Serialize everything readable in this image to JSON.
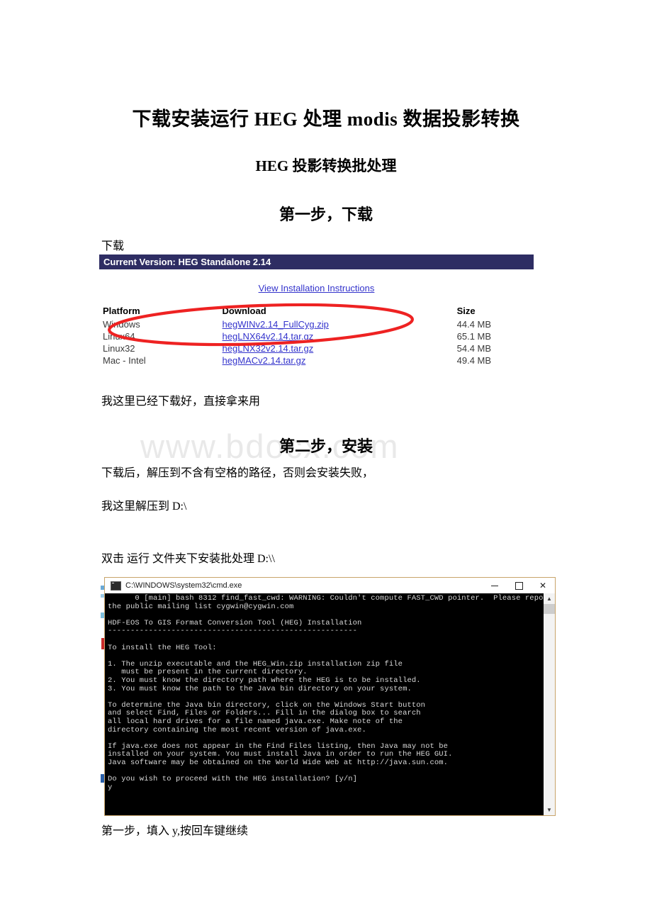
{
  "document": {
    "title_main": "下载安装运行 HEG 处理 modis 数据投影转换",
    "title_sub": "HEG 投影转换批处理",
    "step1_heading": "第一步，下载",
    "step2_heading": "第二步，安装",
    "watermark": "www.bdocx.com",
    "paragraphs": {
      "download_label": "下载",
      "already_downloaded": "我这里已经下载好，直接拿来用",
      "unzip_note": "下载后，解压到不含有空格的路径，否则会安装失败，",
      "unzip_path": "我这里解压到 D:\\",
      "double_click": "双击 运行 文件夹下安装批处理 D:\\\\",
      "first_step_note": "第一步，填入 y,按回车键继续"
    }
  },
  "download_panel": {
    "version_bar": "Current Version: HEG Standalone 2.14",
    "version_bar_color": "#2e2d63",
    "instructions_link": "View Installation Instructions",
    "link_color": "#3333cc",
    "highlight_color": "#ee2222",
    "table": {
      "headers": [
        "Platform",
        "Download",
        "Size"
      ],
      "rows": [
        {
          "platform": "Windows",
          "file": "hegWINv2.14_FullCyg.zip",
          "size": "44.4 MB"
        },
        {
          "platform": "Linux64",
          "file": "hegLNX64v2.14.tar.gz",
          "size": "65.1 MB"
        },
        {
          "platform": "Linux32",
          "file": "hegLNX32v2.14.tar.gz",
          "size": "54.4 MB"
        },
        {
          "platform": "Mac - Intel",
          "file": "hegMACv2.14.tar.gz",
          "size": "49.4 MB"
        }
      ]
    }
  },
  "terminal": {
    "title": "C:\\WINDOWS\\system32\\cmd.exe",
    "controls": {
      "minimize": "minimize",
      "maximize": "maximize",
      "close": "✕"
    },
    "console_text": "      0 [main] bash 8312 find_fast_cwd: WARNING: Couldn't compute FAST_CWD pointer.  Please report this problem to\nthe public mailing list cygwin@cygwin.com\n\nHDF-EOS To GIS Format Conversion Tool (HEG) Installation\n-------------------------------------------------------\n\nTo install the HEG Tool:\n\n1. The unzip executable and the HEG_Win.zip installation zip file\n   must be present in the current directory.\n2. You must know the directory path where the HEG is to be installed.\n3. You must know the path to the Java bin directory on your system.\n\nTo determine the Java bin directory, click on the Windows Start button\nand select Find, Files or Folders... Fill in the dialog box to search\nall local hard drives for a file named java.exe. Make note of the\ndirectory containing the most recent version of java.exe.\n\nIf java.exe does not appear in the Find Files listing, then Java may not be\ninstalled on your system. You must install Java in order to run the HEG GUI.\nJava software may be obtained on the World Wide Web at http://java.sun.com.\n\nDo you wish to proceed with the HEG installation? [y/n]\ny"
  }
}
